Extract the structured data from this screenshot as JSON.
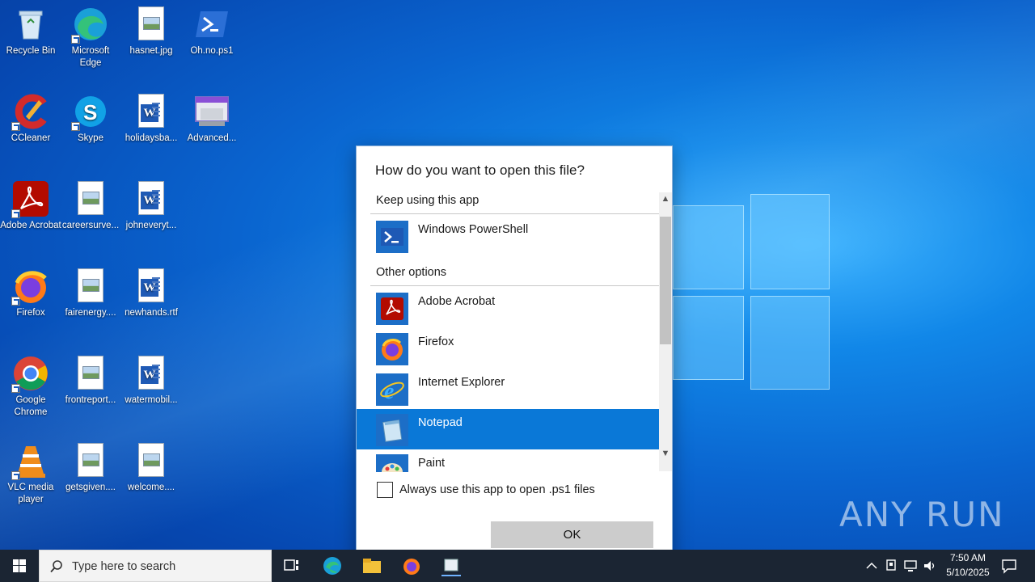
{
  "desktop": {
    "icons": [
      {
        "label": "Recycle Bin",
        "icon": "recycle-bin-icon"
      },
      {
        "label": "Microsoft Edge",
        "icon": "edge-icon"
      },
      {
        "label": "hasnet.jpg",
        "icon": "image-file-icon"
      },
      {
        "label": "Oh.no.ps1",
        "icon": "powershell-icon"
      },
      {
        "label": "CCleaner",
        "icon": "ccleaner-icon"
      },
      {
        "label": "Skype",
        "icon": "skype-icon"
      },
      {
        "label": "holidaysba...",
        "icon": "word-doc-icon"
      },
      {
        "label": "Advanced...",
        "icon": "advanced-app-icon"
      },
      {
        "label": "Adobe Acrobat",
        "icon": "acrobat-icon"
      },
      {
        "label": "careersurve...",
        "icon": "image-file-icon"
      },
      {
        "label": "johneveryt...",
        "icon": "word-doc-icon"
      },
      {
        "label": "Firefox",
        "icon": "firefox-icon"
      },
      {
        "label": "fairenergy....",
        "icon": "image-file-icon"
      },
      {
        "label": "newhands.rtf",
        "icon": "word-doc-icon"
      },
      {
        "label": "Google Chrome",
        "icon": "chrome-icon"
      },
      {
        "label": "frontreport...",
        "icon": "image-file-icon"
      },
      {
        "label": "watermobil...",
        "icon": "word-doc-icon"
      },
      {
        "label": "VLC media player",
        "icon": "vlc-icon"
      },
      {
        "label": "getsgiven....",
        "icon": "image-file-icon"
      },
      {
        "label": "welcome....",
        "icon": "image-file-icon"
      }
    ]
  },
  "dialog": {
    "title": "How do you want to open this file?",
    "keep_header": "Keep using this app",
    "keep_app": {
      "label": "Windows PowerShell",
      "icon": "powershell-icon"
    },
    "other_header": "Other options",
    "other_apps": [
      {
        "label": "Adobe Acrobat",
        "icon": "acrobat-icon"
      },
      {
        "label": "Firefox",
        "icon": "firefox-icon"
      },
      {
        "label": "Internet Explorer",
        "icon": "internet-explorer-icon"
      },
      {
        "label": "Notepad",
        "icon": "notepad-icon",
        "selected": true
      },
      {
        "label": "Paint",
        "icon": "paint-icon"
      }
    ],
    "checkbox_label": "Always use this app to open .ps1 files",
    "checkbox_checked": false,
    "ok_label": "OK"
  },
  "taskbar": {
    "search_placeholder": "Type here to search",
    "time": "7:50 AM",
    "date": "5/10/2025"
  },
  "watermark": "ANY RUN",
  "colors": {
    "selection": "#0a78d7",
    "taskbar": "#1b2533",
    "accent": "#1c6ec7"
  }
}
